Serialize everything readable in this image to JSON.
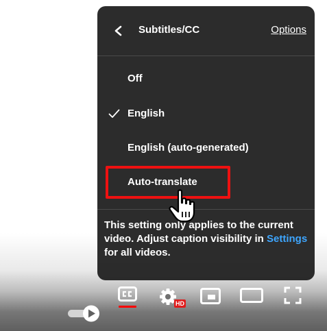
{
  "menu": {
    "title": "Subtitles/CC",
    "options_label": "Options",
    "items": [
      {
        "label": "Off",
        "selected": false
      },
      {
        "label": "English",
        "selected": true
      },
      {
        "label": "English (auto-generated)",
        "selected": false
      },
      {
        "label": "Auto-translate",
        "selected": false
      }
    ],
    "note_before": "This setting only applies to the current video. Adjust caption visibility in ",
    "note_link": "Settings",
    "note_after": " for all videos."
  },
  "controls": {
    "hd_badge": "HD",
    "accent_color": "#ff0000",
    "link_color": "#3ea6ff"
  }
}
